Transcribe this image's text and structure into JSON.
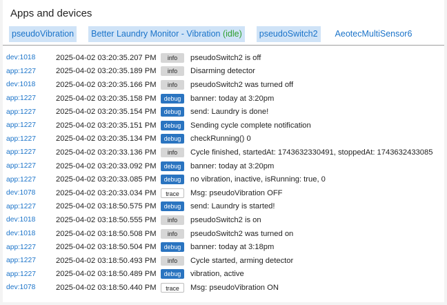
{
  "header": {
    "title": "Apps and devices"
  },
  "chips": [
    {
      "label": "pseudoVibration",
      "status": "",
      "active": true
    },
    {
      "label": "Better Laundry Monitor - Vibration ",
      "status": "(idle)",
      "active": true
    },
    {
      "label": "pseudoSwitch2",
      "status": "",
      "active": true
    },
    {
      "label": "AeotecMultiSensor6",
      "status": "",
      "active": false
    }
  ],
  "logs": [
    {
      "source": "dev:1018",
      "time": "2025-04-02 03:20:35.207 PM",
      "level": "info",
      "message": "pseudoSwitch2 is off"
    },
    {
      "source": "app:1227",
      "time": "2025-04-02 03:20:35.189 PM",
      "level": "info",
      "message": "Disarming detector"
    },
    {
      "source": "dev:1018",
      "time": "2025-04-02 03:20:35.166 PM",
      "level": "info",
      "message": "pseudoSwitch2 was turned off"
    },
    {
      "source": "app:1227",
      "time": "2025-04-02 03:20:35.158 PM",
      "level": "debug",
      "message": "banner: today at 3:20pm"
    },
    {
      "source": "app:1227",
      "time": "2025-04-02 03:20:35.154 PM",
      "level": "debug",
      "message": "send: Laundry is done!"
    },
    {
      "source": "app:1227",
      "time": "2025-04-02 03:20:35.151 PM",
      "level": "debug",
      "message": "Sending cycle complete notification"
    },
    {
      "source": "app:1227",
      "time": "2025-04-02 03:20:35.134 PM",
      "level": "debug",
      "message": "checkRunning() 0"
    },
    {
      "source": "app:1227",
      "time": "2025-04-02 03:20:33.136 PM",
      "level": "info",
      "message": "Cycle finished, startedAt: 1743632330491, stoppedAt: 1743632433085"
    },
    {
      "source": "app:1227",
      "time": "2025-04-02 03:20:33.092 PM",
      "level": "debug",
      "message": "banner: today at 3:20pm"
    },
    {
      "source": "app:1227",
      "time": "2025-04-02 03:20:33.085 PM",
      "level": "debug",
      "message": "no vibration, inactive, isRunning: true, 0"
    },
    {
      "source": "dev:1078",
      "time": "2025-04-02 03:20:33.034 PM",
      "level": "trace",
      "message": "Msg: pseudoVibration OFF"
    },
    {
      "source": "app:1227",
      "time": "2025-04-02 03:18:50.575 PM",
      "level": "debug",
      "message": "send: Laundry is started!"
    },
    {
      "source": "dev:1018",
      "time": "2025-04-02 03:18:50.555 PM",
      "level": "info",
      "message": "pseudoSwitch2 is on"
    },
    {
      "source": "dev:1018",
      "time": "2025-04-02 03:18:50.508 PM",
      "level": "info",
      "message": "pseudoSwitch2 was turned on"
    },
    {
      "source": "app:1227",
      "time": "2025-04-02 03:18:50.504 PM",
      "level": "debug",
      "message": "banner: today at 3:18pm"
    },
    {
      "source": "app:1227",
      "time": "2025-04-02 03:18:50.493 PM",
      "level": "info",
      "message": "Cycle started, arming detector"
    },
    {
      "source": "app:1227",
      "time": "2025-04-02 03:18:50.489 PM",
      "level": "debug",
      "message": "vibration, active"
    },
    {
      "source": "dev:1078",
      "time": "2025-04-02 03:18:50.440 PM",
      "level": "trace",
      "message": "Msg: pseudoVibration ON"
    }
  ]
}
